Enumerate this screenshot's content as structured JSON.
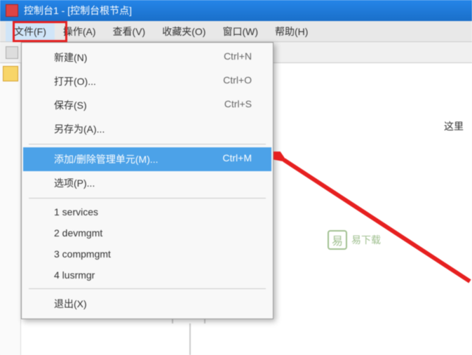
{
  "titlebar": {
    "title": "控制台1 - [控制台根节点]"
  },
  "menubar": {
    "file": "文件(F)",
    "action": "操作(A)",
    "view": "查看(V)",
    "favorites": "收藏夹(O)",
    "window": "窗口(W)",
    "help": "帮助(H)"
  },
  "dropdown": {
    "new_label": "新建(N)",
    "new_shortcut": "Ctrl+N",
    "open_label": "打开(O)...",
    "open_shortcut": "Ctrl+O",
    "save_label": "保存(S)",
    "save_shortcut": "Ctrl+S",
    "saveas_label": "另存为(A)...",
    "snapin_label": "添加/删除管理单元(M)...",
    "snapin_shortcut": "Ctrl+M",
    "options_label": "选项(P)...",
    "recent1": "1 services",
    "recent2": "2 devmgmt",
    "recent3": "3 compmgmt",
    "recent4": "4 lusrmgr",
    "exit_label": "退出(X)"
  },
  "watermark": {
    "text": "易下载"
  },
  "right_text": "这里"
}
